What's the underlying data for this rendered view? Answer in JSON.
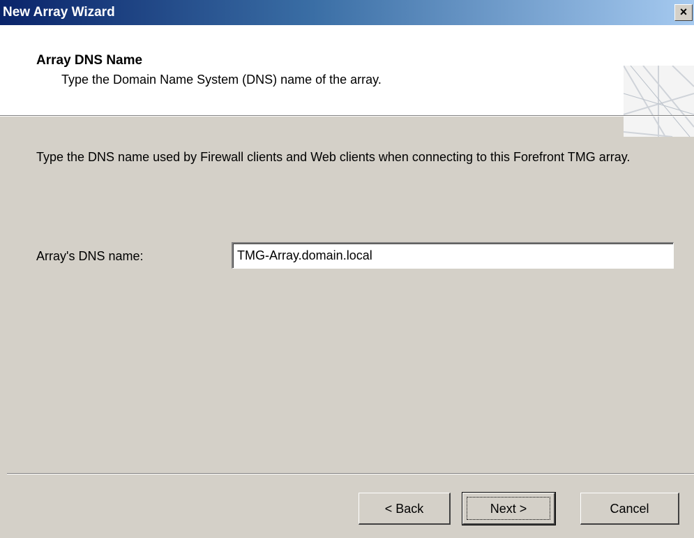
{
  "window": {
    "title": "New Array Wizard",
    "close_label": "×"
  },
  "header": {
    "title": "Array DNS Name",
    "subtitle": "Type the Domain Name System (DNS) name of the array."
  },
  "body": {
    "description": "Type the DNS name used by Firewall clients and Web clients when connecting to this Forefront TMG array.",
    "dns_field": {
      "label": "Array's DNS name:",
      "value": "TMG-Array.domain.local"
    }
  },
  "buttons": {
    "back": "< Back",
    "next": "Next >",
    "cancel": "Cancel"
  }
}
